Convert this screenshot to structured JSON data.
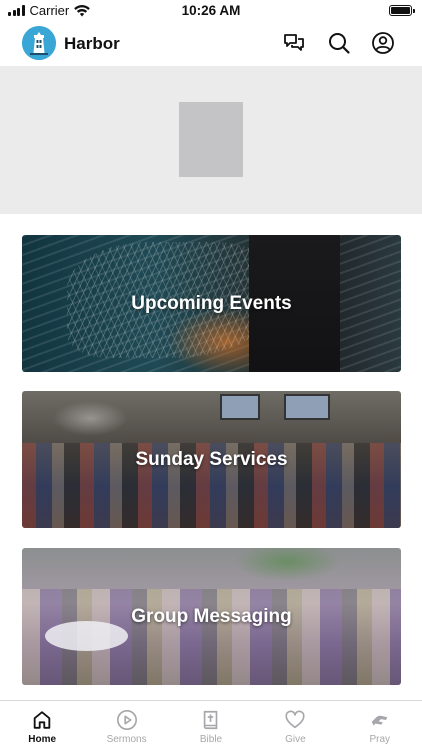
{
  "status_bar": {
    "carrier": "Carrier",
    "time": "10:26 AM",
    "icons": [
      "signal-icon",
      "wifi-icon",
      "battery-icon"
    ]
  },
  "header": {
    "app_name": "Harbor",
    "icons": [
      "chat-bubbles-icon",
      "search-icon",
      "profile-icon"
    ]
  },
  "cards": [
    {
      "label": "Upcoming Events"
    },
    {
      "label": "Sunday Services"
    },
    {
      "label": "Group Messaging"
    }
  ],
  "tab_bar": {
    "active": "Home",
    "tabs": [
      {
        "label": "Home",
        "icon": "home-icon"
      },
      {
        "label": "Sermons",
        "icon": "play-circle-icon"
      },
      {
        "label": "Bible",
        "icon": "bible-icon"
      },
      {
        "label": "Give",
        "icon": "heart-icon"
      },
      {
        "label": "Pray",
        "icon": "pray-hands-icon"
      }
    ]
  },
  "colors": {
    "brand": "#3aa6d6",
    "inactive_tab": "#a7a7ab",
    "hero_background": "#ebebeb"
  }
}
